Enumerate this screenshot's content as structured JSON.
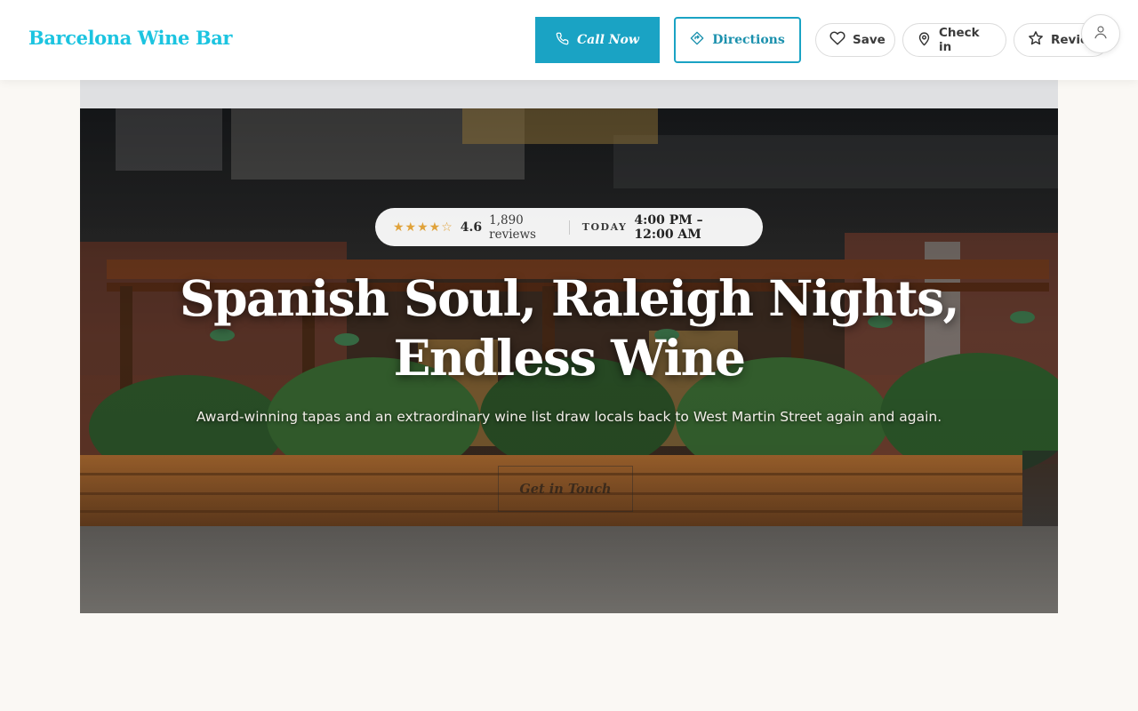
{
  "header": {
    "brand": "Barcelona Wine Bar",
    "call_label": "Call Now",
    "directions_label": "Directions",
    "save_label": "Save",
    "checkin_label": "Check in",
    "review_label": "Review"
  },
  "hero": {
    "stars": "★★★★☆",
    "rating": "4.6",
    "review_count": "1,890 reviews",
    "today_label": "TODAY",
    "hours": "4:00 PM – 12:00 AM",
    "headline_line1": "Spanish Soul, Raleigh Nights,",
    "headline_line2": "Endless Wine",
    "subline": "Award-winning tapas and an extraordinary wine list draw locals back to West Martin Street again and again.",
    "cta_label": "Get in Touch"
  },
  "colors": {
    "brand": "#1cc4e0",
    "accent": "#1aa3c4",
    "star": "#e0a23a",
    "page_bg": "#faf8f4"
  },
  "icons": [
    "phone-icon",
    "directions-icon",
    "heart-icon",
    "location-pin-icon",
    "star-icon",
    "user-icon"
  ]
}
